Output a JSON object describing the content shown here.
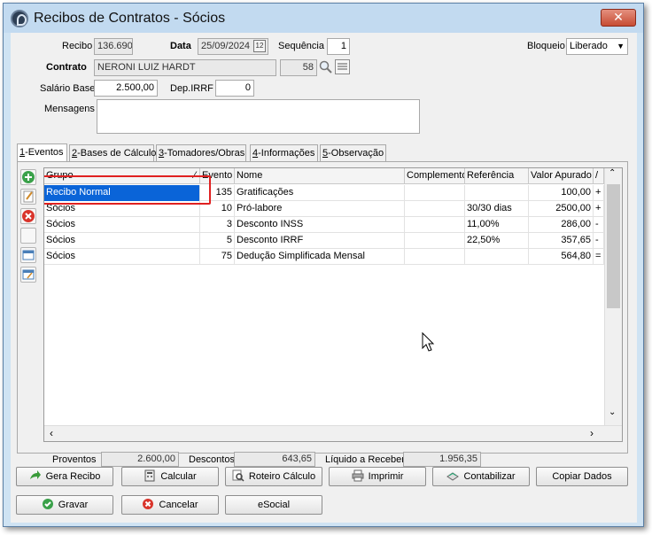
{
  "window": {
    "title": "Recibos de Contratos - Sócios"
  },
  "header": {
    "recibo_label": "Recibo",
    "recibo_value": "136.690",
    "data_label": "Data",
    "data_value": "25/09/2024",
    "calendar_glyph": "12",
    "sequencia_label": "Sequência",
    "sequencia_value": "1",
    "bloqueio_label": "Bloqueio",
    "bloqueio_value": "Liberado",
    "contrato_label": "Contrato",
    "contrato_name": "NERONI LUIZ HARDT",
    "contrato_code": "58",
    "salario_label": "Salário Base",
    "salario_value": "2.500,00",
    "depirrf_label": "Dep.IRRF",
    "depirrf_value": "0",
    "mensagens_label": "Mensagens",
    "mensagens_value": ""
  },
  "tabs": [
    {
      "key": "1",
      "label": "-Eventos"
    },
    {
      "key": "2",
      "label": "-Bases de Cálculo"
    },
    {
      "key": "3",
      "label": "-Tomadores/Obras"
    },
    {
      "key": "4",
      "label": "-Informações"
    },
    {
      "key": "5",
      "label": "-Observação"
    }
  ],
  "grid": {
    "columns": [
      "Grupo",
      "Evento",
      "Nome",
      "Complemento",
      "Referência",
      "Valor Apurado",
      "/"
    ],
    "rows": [
      {
        "grupo": "Recibo Normal",
        "evento": "135",
        "nome": "Gratificações",
        "complemento": "",
        "referencia": "",
        "valor": "100,00",
        "sinal": "+"
      },
      {
        "grupo": "Sócios",
        "evento": "10",
        "nome": "Pró-labore",
        "complemento": "",
        "referencia": "30/30 dias",
        "valor": "2500,00",
        "sinal": "+"
      },
      {
        "grupo": "Sócios",
        "evento": "3",
        "nome": "Desconto INSS",
        "complemento": "",
        "referencia": "11,00%",
        "valor": "286,00",
        "sinal": "-"
      },
      {
        "grupo": "Sócios",
        "evento": "5",
        "nome": "Desconto IRRF",
        "complemento": "",
        "referencia": "22,50%",
        "valor": "357,65",
        "sinal": "-"
      },
      {
        "grupo": "Sócios",
        "evento": "75",
        "nome": "Dedução Simplificada Mensal",
        "complemento": "",
        "referencia": "",
        "valor": "564,80",
        "sinal": "="
      }
    ]
  },
  "totals": {
    "proventos_label": "Proventos",
    "proventos_value": "2.600,00",
    "descontos_label": "Descontos",
    "descontos_value": "643,65",
    "liquido_label": "Líquido a Receber",
    "liquido_value": "1.956,35"
  },
  "buttons": {
    "gera_recibo": "Gera Recibo",
    "calcular": "Calcular",
    "roteiro": "Roteiro Cálculo",
    "imprimir": "Imprimir",
    "contabilizar": "Contabilizar",
    "copiar": "Copiar Dados",
    "gravar": "Gravar",
    "cancelar": "Cancelar",
    "esocial": "eSocial"
  },
  "colors": {
    "window_bg": "#cfe3f3",
    "selection": "#0a64d8",
    "highlight_box": "#e02020",
    "close": "#c74c34"
  }
}
